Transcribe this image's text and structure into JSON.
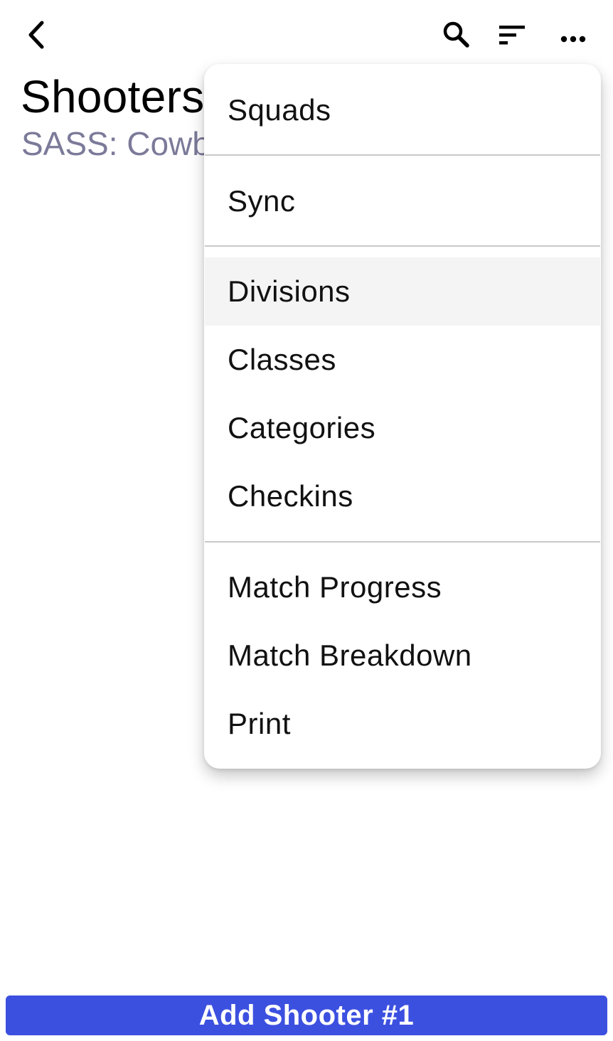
{
  "header": {
    "title": "Shooters",
    "subtitle": "SASS: Cowboy"
  },
  "toolbar": {
    "back_icon": "chevron-left-icon",
    "search_icon": "search-icon",
    "sort_icon": "sort-icon",
    "more_icon": "more-horizontal-icon"
  },
  "menu": {
    "items": [
      {
        "label": "Squads"
      },
      {
        "label": "Sync"
      },
      {
        "label": "Divisions"
      },
      {
        "label": "Classes"
      },
      {
        "label": "Categories"
      },
      {
        "label": "Checkins"
      },
      {
        "label": "Match Progress"
      },
      {
        "label": "Match Breakdown"
      },
      {
        "label": "Print"
      }
    ]
  },
  "footer": {
    "add_button_label": "Add Shooter #1"
  },
  "colors": {
    "accent": "#3c50e0",
    "subtitle": "#7b7a99",
    "menu_hover": "#f4f4f4",
    "divider": "#c9c9c9"
  }
}
